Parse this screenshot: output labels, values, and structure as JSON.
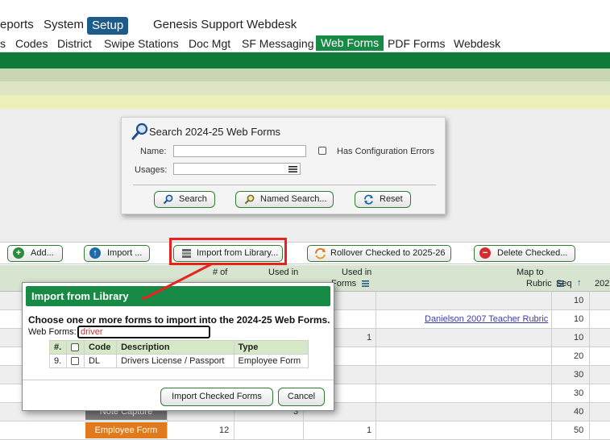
{
  "nav_top": {
    "reports": "eports",
    "system": "System",
    "setup": "Setup",
    "genesis_support": "Genesis Support",
    "webdesk": "Webdesk"
  },
  "nav_sub": {
    "s": "s",
    "codes": "Codes",
    "district": "District",
    "swipe_stations": "Swipe Stations",
    "doc_mgt": "Doc Mgt",
    "sf_messaging": "SF Messaging",
    "web_forms": "Web Forms",
    "pdf_forms": "PDF Forms",
    "webdesk": "Webdesk"
  },
  "search": {
    "title": "Search 2024-25 Web Forms",
    "name_label": "Name:",
    "usages_label": "Usages:",
    "config_errors_label": "Has Configuration Errors",
    "search_button": "Search",
    "named_search_button": "Named Search...",
    "reset_button": "Reset"
  },
  "actions": {
    "add": "Add...",
    "import": "Import ...",
    "import_library": "Import from Library...",
    "rollover": "Rollover Checked to 2025-26",
    "delete": "Delete Checked..."
  },
  "table": {
    "headers": {
      "num_of": "# of",
      "used_in_1": "Used in",
      "used_in_2": "Used in",
      "forms": "Forms",
      "map_to": "Map to",
      "rubric": "Rubric",
      "seq": "Seq",
      "year": "202"
    },
    "rows": [
      {
        "seq": "10",
        "link": "",
        "used": "",
        "badge": ""
      },
      {
        "seq": "10",
        "link": "Danielson 2007 Teacher Rubric",
        "used": "",
        "badge": ""
      },
      {
        "seq": "10",
        "link": "",
        "used": "1",
        "badge": ""
      },
      {
        "seq": "20",
        "link": "",
        "used": "",
        "badge": ""
      },
      {
        "seq": "30",
        "link": "",
        "used": "",
        "badge": ""
      },
      {
        "seq": "30",
        "link": "",
        "used": "",
        "badge": ""
      },
      {
        "seq": "40",
        "link": "",
        "used": "3",
        "badge": "Note Capture"
      },
      {
        "seq": "50",
        "link": "",
        "used": "1",
        "badge": "Employee Form",
        "num": "12"
      }
    ]
  },
  "modal": {
    "title": "Import from Library",
    "choose_text": "Choose one or more forms to import into the 2024-25 Web Forms.",
    "web_forms_label": "Web Forms:",
    "web_forms_value": "driver",
    "columns": {
      "num": "#.",
      "code": "Code",
      "description": "Description",
      "type": "Type"
    },
    "rows": [
      {
        "num": "9.",
        "code": "DL",
        "description": "Drivers License / Passport",
        "type": "Employee Form"
      }
    ],
    "import_button": "Import Checked Forms",
    "cancel_button": "Cancel"
  },
  "colors": {
    "accent_green": "#178a46",
    "highlight_red": "#e8231e",
    "setup_blue": "#1d5c8a"
  }
}
